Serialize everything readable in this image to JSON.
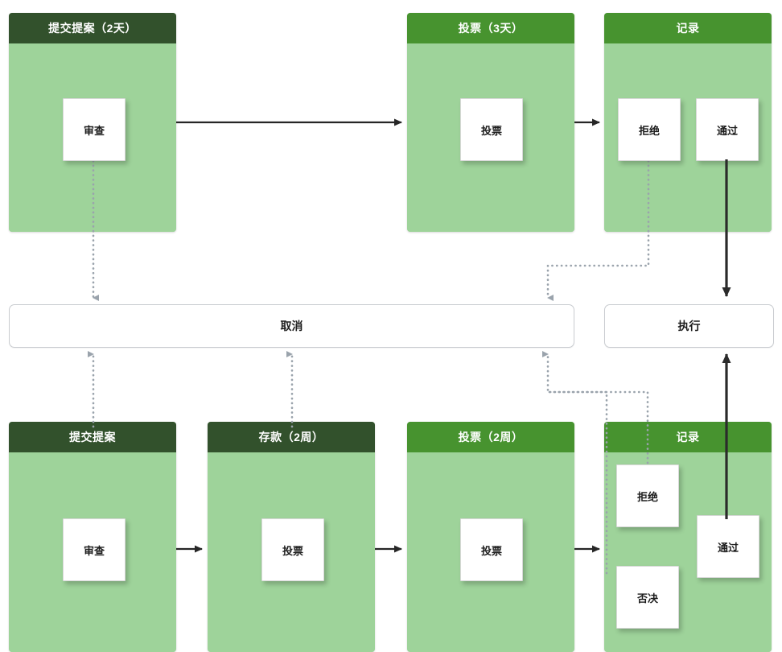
{
  "diagram": {
    "title": "",
    "colors": {
      "header_dark": "#32512c",
      "header_bright": "#47932f",
      "panel_body": "#9ed39a",
      "task_box": "#ffffff",
      "solid_arrow": "#262626",
      "dotted_arrow": "#9aa3ac"
    },
    "top_row": {
      "panels": [
        {
          "id": "submit-proposal-2d",
          "header": "提交提案（2天）",
          "header_style": "dark",
          "tasks": [
            {
              "label": "审查"
            }
          ]
        },
        {
          "id": "vote-3d",
          "header": "投票（3天）",
          "header_style": "bright",
          "tasks": [
            {
              "label": "投票"
            }
          ]
        },
        {
          "id": "record-top",
          "header": "记录",
          "header_style": "bright",
          "tasks": [
            {
              "label": "拒绝"
            },
            {
              "label": "通过"
            }
          ]
        }
      ]
    },
    "middle_row": {
      "bars": [
        {
          "id": "cancel",
          "label": "取消"
        },
        {
          "id": "execute",
          "label": "执行"
        }
      ]
    },
    "bottom_row": {
      "panels": [
        {
          "id": "submit-proposal",
          "header": "提交提案",
          "header_style": "dark",
          "tasks": [
            {
              "label": "审查"
            }
          ]
        },
        {
          "id": "deposit-2w",
          "header": "存款（2周）",
          "header_style": "dark",
          "tasks": [
            {
              "label": "投票"
            }
          ]
        },
        {
          "id": "vote-2w",
          "header": "投票（2周）",
          "header_style": "bright",
          "tasks": [
            {
              "label": "投票"
            }
          ]
        },
        {
          "id": "record-bottom",
          "header": "记录",
          "header_style": "bright",
          "tasks": [
            {
              "label": "拒绝"
            },
            {
              "label": "否决"
            },
            {
              "label": "通过"
            }
          ]
        }
      ]
    }
  }
}
